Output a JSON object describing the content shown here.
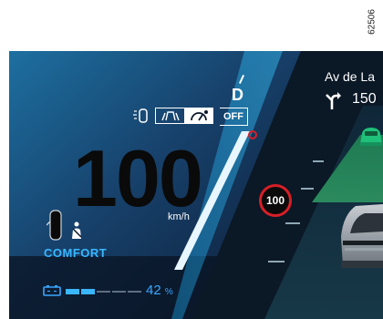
{
  "figure_ref": "62506",
  "colors": {
    "accent_blue": "#39b6ff",
    "speed_limit_ring": "#d71f26",
    "lead_car_green": "#1fc07a",
    "lane_green": "#1e7a52",
    "background": "#0d1a2c"
  },
  "drive": {
    "gear": "D",
    "aid_mode_label": "OFF",
    "speed": "100",
    "speed_unit": "km/h",
    "drive_mode": "COMFORT"
  },
  "speed_limit": {
    "value": "100"
  },
  "navigation": {
    "street": "Av de La",
    "distance": "150",
    "turn_icon": "turn-right-arrow-icon"
  },
  "battery": {
    "percent": "42",
    "unit": "%",
    "level": 0.42,
    "icon": "battery-icon"
  },
  "icons": [
    "driver-assist-car-icon",
    "lane-keeping-icon",
    "speed-regulator-icon",
    "door-car-topview-icon",
    "seatbelt-icon",
    "lead-vehicle-icon",
    "ego-vehicle-icon"
  ]
}
